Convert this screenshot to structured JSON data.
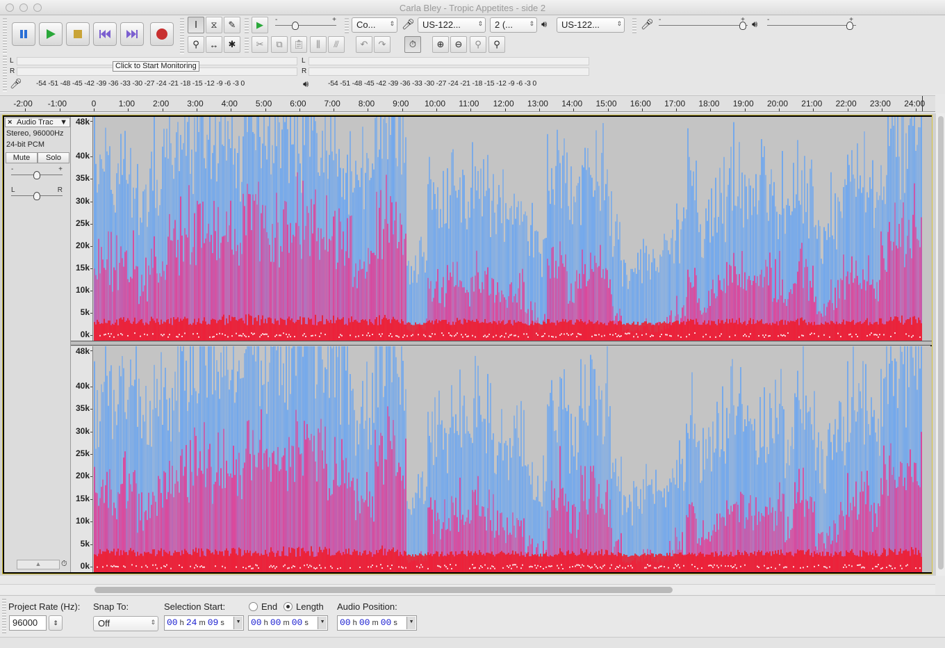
{
  "window": {
    "title": "Carla Bley - Tropic Appetites - side 2"
  },
  "transport": {
    "pause": "pause-icon",
    "play": "play-icon",
    "stop": "stop-icon",
    "skip_start": "skip-start-icon",
    "skip_end": "skip-end-icon",
    "record": "record-icon"
  },
  "device_toolbar": {
    "host": "Co...",
    "recording_device": "US-122...",
    "channels": "2 (...",
    "playback_device": "US-122..."
  },
  "meters": {
    "monitor_tooltip": "Click to Start Monitoring",
    "left": "L",
    "right": "R",
    "scale": "-54 -51 -48 -45 -42 -39 -36 -33 -30 -27 -24 -21 -18 -15 -12  -9  -6  -3  0"
  },
  "ruler": {
    "ticks": [
      "-2:00",
      "-1:00",
      "0",
      "1:00",
      "2:00",
      "3:00",
      "4:00",
      "5:00",
      "6:00",
      "7:00",
      "8:00",
      "9:00",
      "10:00",
      "11:00",
      "12:00",
      "13:00",
      "14:00",
      "15:00",
      "16:00",
      "17:00",
      "18:00",
      "19:00",
      "20:00",
      "21:00",
      "22:00",
      "23:00",
      "24:00"
    ]
  },
  "track": {
    "name": "Audio Trac",
    "format": "Stereo, 96000Hz",
    "bit_depth": "24-bit PCM",
    "mute": "Mute",
    "solo": "Solo",
    "gain_minus": "-",
    "gain_plus": "+",
    "pan_left": "L",
    "pan_right": "R",
    "freq_labels": [
      "48k",
      "40k",
      "35k",
      "30k",
      "25k",
      "20k",
      "15k",
      "10k",
      "5k",
      "0k"
    ]
  },
  "spectrogram": {
    "colors": {
      "background": "#c4c4c4",
      "low": "#6aa5f0",
      "mid": "#f0308a",
      "high": "#f01a28",
      "peak": "#ffffff"
    },
    "duration_min": 24.1,
    "energy": [
      0.62,
      0.64,
      0.66,
      0.66,
      0.55,
      0.64,
      0.7,
      0.72,
      0.78,
      0.8,
      0.8,
      0.8,
      0.79,
      0.78,
      0.82,
      0.84,
      0.84,
      0.82,
      0.83,
      0.82,
      0.8,
      0.8,
      0.78,
      0.72,
      0.6,
      0.64,
      0.82,
      0.9,
      0.78,
      0.25,
      0.3,
      0.55,
      0.5,
      0.55,
      0.5,
      0.58,
      0.55,
      0.5,
      0.48,
      0.5,
      0.38,
      0.35,
      0.6,
      0.68,
      0.5,
      0.62,
      0.65,
      0.6,
      0.42,
      0.25,
      0.28,
      0.32,
      0.3,
      0.35,
      0.38,
      0.58,
      0.42,
      0.45,
      0.55,
      0.6,
      0.55,
      0.5,
      0.58,
      0.55,
      0.5,
      0.62,
      0.55,
      0.4,
      0.45,
      0.55,
      0.62,
      0.6,
      0.55,
      0.72,
      0.78,
      0.8,
      0.82
    ]
  },
  "selection_toolbar": {
    "project_rate_label": "Project Rate (Hz):",
    "project_rate_value": "96000",
    "snap_to_label": "Snap To:",
    "snap_to_value": "Off",
    "selection_start_label": "Selection Start:",
    "end_label": "End",
    "length_label": "Length",
    "audio_position_label": "Audio Position:",
    "selection_start": {
      "h": "00",
      "m": "24",
      "s": "09"
    },
    "selection_length": {
      "h": "00",
      "m": "00",
      "s": "00"
    },
    "audio_position": {
      "h": "00",
      "m": "00",
      "s": "00"
    }
  }
}
